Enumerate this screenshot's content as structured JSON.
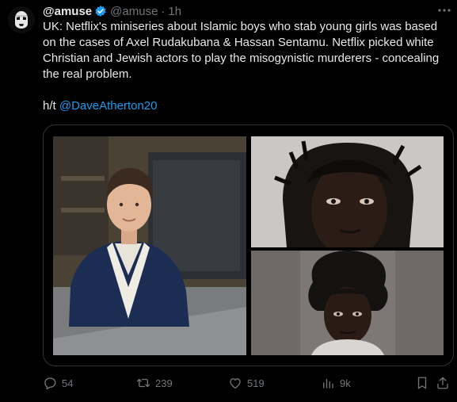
{
  "tweet": {
    "display_name": "@amuse",
    "handle": "@amuse",
    "separator": "·",
    "time": "1h",
    "text": "UK: Netflix's miniseries about Islamic boys who stab young girls was based on the cases of Axel Rudakubana & Hassan Sentamu. Netflix picked white Christian and Jewish actors to play the misogynistic murderers - concealing the real problem.",
    "ht_prefix": "h/t ",
    "ht_mention": "@DaveAtherton20"
  },
  "actions": {
    "replies": "54",
    "reposts": "239",
    "likes": "519",
    "views": "9k"
  },
  "colors": {
    "accent": "#1d9bf0",
    "muted": "#71767b",
    "text": "#e7e9ea",
    "background": "#000000"
  }
}
